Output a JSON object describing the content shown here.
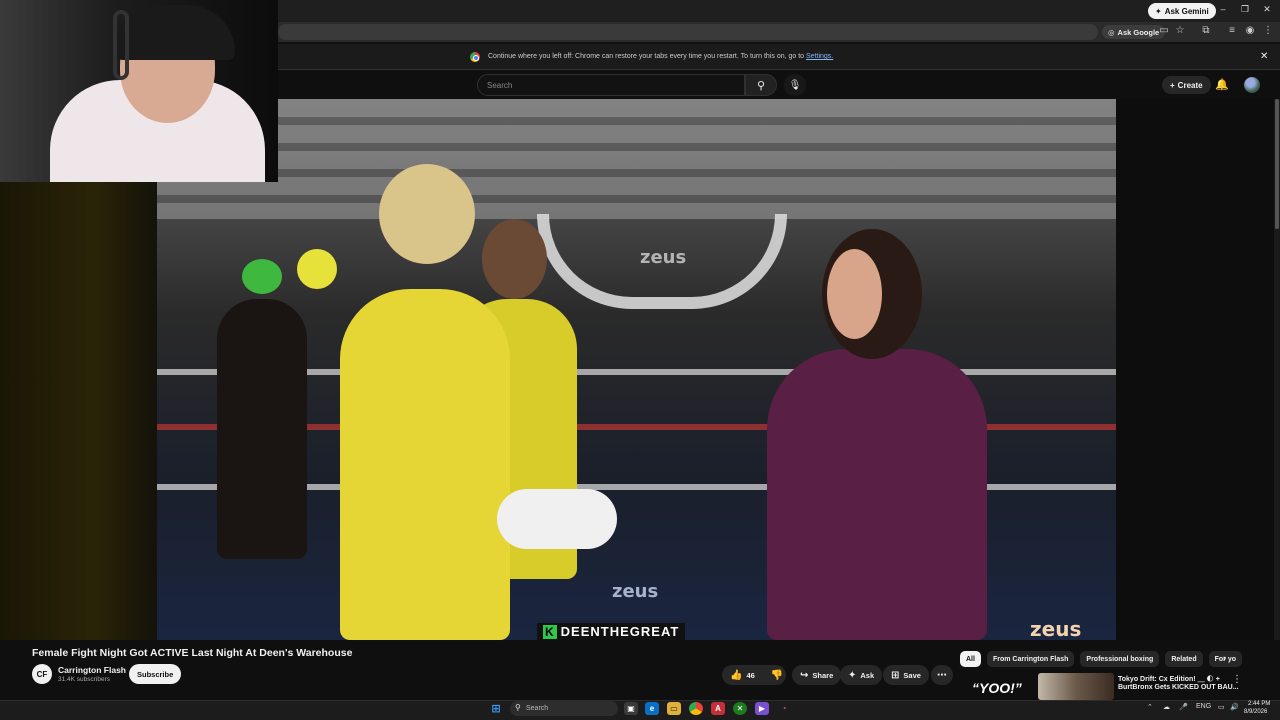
{
  "browser": {
    "ask_gemini": "Ask Gemini",
    "ask_google": "Ask Google",
    "restore_message": "Continue where you left off: Chrome can restore your tabs every time you restart. To turn this on, go to ",
    "restore_link": "Settings."
  },
  "youtube": {
    "search_placeholder": "Search",
    "create_label": "Create"
  },
  "video": {
    "caption_tag": "DEENTHEGREAT",
    "caption_tag_k": "K",
    "watermark_main": "zeus",
    "watermark_floor": "zeus",
    "watermark_back": "zeus"
  },
  "watch": {
    "title": "Female Fight Night Got ACTIVE Last Night At Deen's Warehouse",
    "channel_name": "Carrington Flash",
    "channel_avatar_text": "CF",
    "subscribers": "31.4K subscribers",
    "subscribe_label": "Subscribe",
    "like_count": "46",
    "share_label": "Share",
    "ask_label": "Ask",
    "save_label": "Save"
  },
  "chips": [
    "All",
    "From Carrington Flash",
    "Professional boxing",
    "Related",
    "For yo"
  ],
  "recommendation": {
    "thumb_text": "“YOO!”",
    "title1": "Tokyo Drift: Cx Edition! ＿ 🌓 +",
    "title2": "BurtBronx Gets KICKED OUT BAU..."
  },
  "taskbar": {
    "search_placeholder": "Search",
    "lang": "ENG",
    "time": "2:44 PM",
    "date": "8/9/2026"
  },
  "colors": {
    "youtube_bg": "#0f0f0f",
    "chip_active": "#f1f1f1",
    "link": "#8ab4f8",
    "caption_accent": "#2ec84a"
  }
}
